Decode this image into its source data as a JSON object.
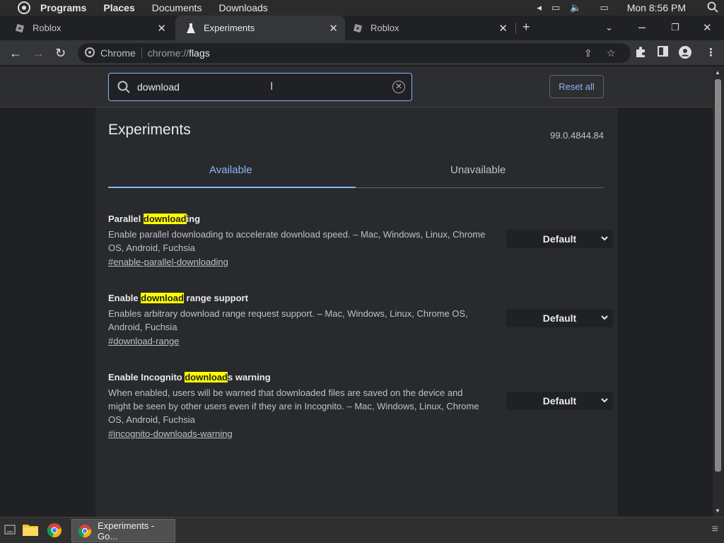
{
  "system": {
    "menu": [
      "Programs",
      "Places",
      "Documents",
      "Downloads"
    ],
    "clock": "Mon 8:56 PM"
  },
  "tabs": [
    {
      "label": "Roblox"
    },
    {
      "label": "Experiments"
    },
    {
      "label": "Roblox"
    }
  ],
  "omnibox": {
    "site": "Chrome",
    "url_prefix": "chrome://",
    "url_path": "flags"
  },
  "search": {
    "value": "download",
    "reset_label": "Reset all"
  },
  "page": {
    "title": "Experiments",
    "version": "99.0.4844.84",
    "tab_available": "Available",
    "tab_unavailable": "Unavailable"
  },
  "flags": [
    {
      "name_pre": "Parallel ",
      "name_hl": "download",
      "name_post": "ing",
      "description": "Enable parallel downloading to accelerate download speed. – Mac, Windows, Linux, Chrome OS, Android, Fuchsia",
      "link": "#enable-parallel-downloading",
      "value": "Default"
    },
    {
      "name_pre": "Enable ",
      "name_hl": "download",
      "name_post": " range support",
      "description": "Enables arbitrary download range request support. – Mac, Windows, Linux, Chrome OS, Android, Fuchsia",
      "link": "#download-range",
      "value": "Default"
    },
    {
      "name_pre": "Enable Incognito ",
      "name_hl": "download",
      "name_post": "s warning",
      "description": "When enabled, users will be warned that downloaded files are saved on the device and might be seen by other users even if they are in Incognito. – Mac, Windows, Linux, Chrome OS, Android, Fuchsia",
      "link": "#incognito-downloads-warning",
      "value": "Default"
    }
  ],
  "taskbar": {
    "active_task": "Experiments - Go..."
  },
  "colors": {
    "accent": "#8ab4f8",
    "highlight": "#ffff00",
    "background": "#202124"
  }
}
